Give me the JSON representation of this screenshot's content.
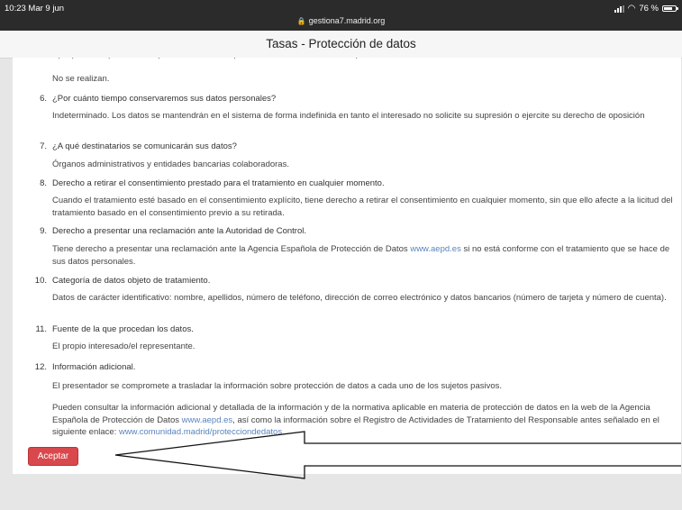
{
  "status_bar": {
    "time": "10:23  Mar 9 jun",
    "url": "gestiona7.madrid.org",
    "battery": "76 %",
    "battery_level": 0.76
  },
  "page": {
    "title": "Tasas - Protección de datos"
  },
  "items": [
    {
      "answer": "No se realizan."
    },
    {
      "num": "6.",
      "question": "¿Por cuánto tiempo conservaremos sus datos personales?",
      "answer": "Indeterminado. Los datos se mantendrán en el sistema de forma indefinida en tanto el interesado no solicite su supresión o ejercite su derecho de oposición"
    },
    {
      "num": "7.",
      "question": "¿A qué destinatarios se comunicarán sus datos?",
      "answer": "Órganos administrativos y entidades bancarias colaboradoras."
    },
    {
      "num": "8.",
      "question": "Derecho a retirar el consentimiento prestado para el tratamiento en cualquier momento.",
      "answer": "Cuando el tratamiento esté basado en el consentimiento explícito, tiene derecho a retirar el consentimiento en cualquier momento, sin que ello afecte a la licitud del tratamiento basado en el consentimiento previo a su retirada."
    },
    {
      "num": "9.",
      "question": "Derecho a presentar una reclamación ante la Autoridad de Control.",
      "answer_pre": "Tiene derecho a presentar una reclamación ante la Agencia Española de Protección de Datos ",
      "answer_link": "www.aepd.es",
      "answer_post": " si no está conforme con el tratamiento que se hace de sus datos personales."
    },
    {
      "num": "10.",
      "question": "Categoría de datos objeto de tratamiento.",
      "answer": "Datos de carácter identificativo: nombre, apellidos, número de teléfono, dirección de correo electrónico y datos bancarios (número de tarjeta y número de cuenta)."
    },
    {
      "num": "11.",
      "question": "Fuente de la que procedan los datos.",
      "answer": "El propio interesado/el representante."
    },
    {
      "num": "12.",
      "question": "Información adicional.",
      "answer": "El presentador se compromete a trasladar la información sobre protección de datos a cada uno de los sujetos pasivos.",
      "answer2_pre": "Pueden consultar la información adicional y detallada de la información y de la normativa aplicable en materia de protección de datos en la web de la Agencia Española de Protección de Datos ",
      "answer2_link1": "www.aepd.es",
      "answer2_mid": ", así como la información sobre el Registro de Actividades de Tratamiento del Responsable antes señalado en el siguiente enlace: ",
      "answer2_link2": "www.comunidad.madrid/protecciondedatos"
    }
  ],
  "accept_button": {
    "label": "Aceptar"
  }
}
